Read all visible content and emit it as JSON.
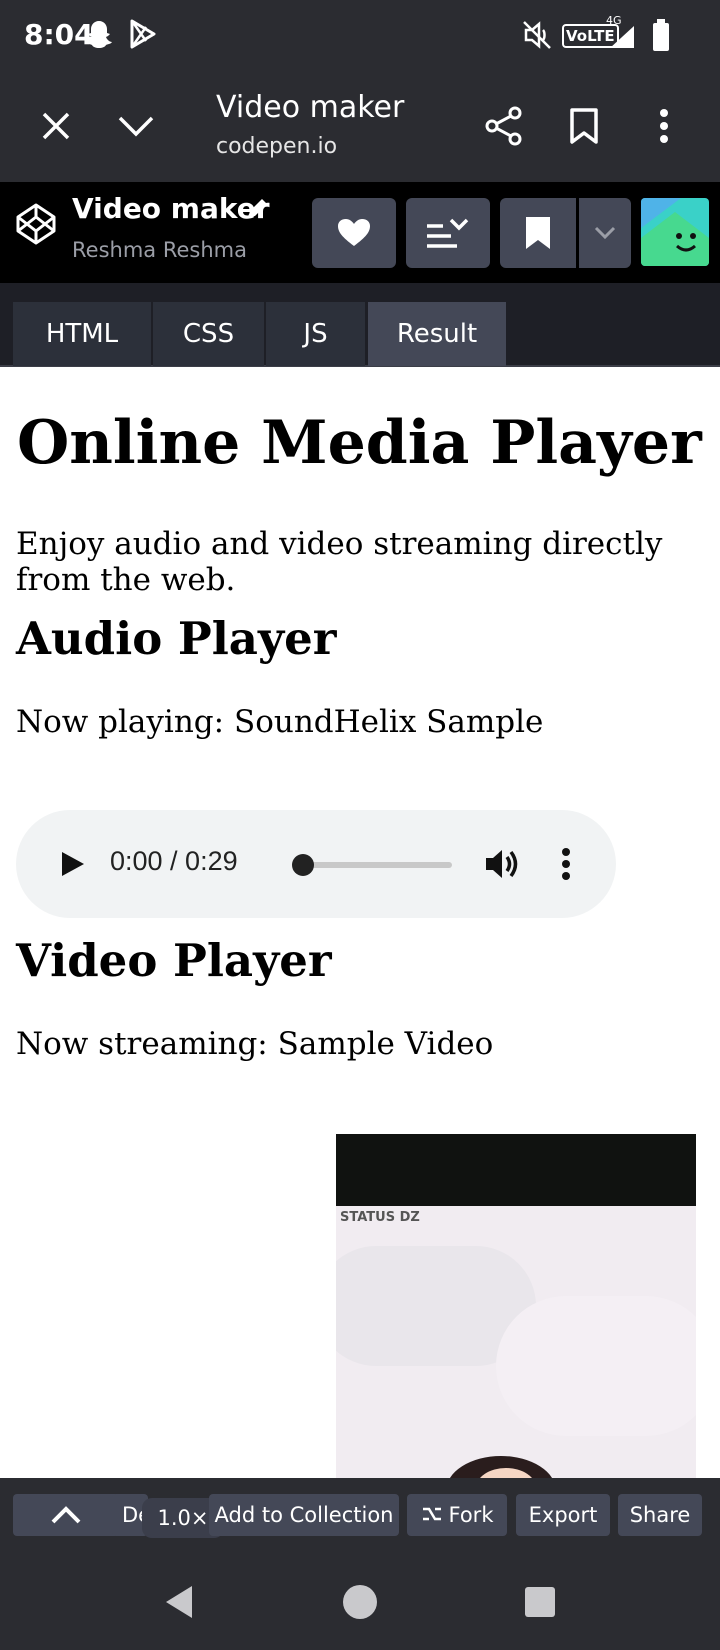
{
  "status_bar": {
    "time": "8:04",
    "icons": [
      "snapchat-icon",
      "play-store-icon",
      "mute-icon",
      "volte-icon",
      "signal-4g-icon",
      "battery-icon"
    ],
    "volte_label": "VoLTE",
    "network_label": "4G"
  },
  "browser": {
    "title": "Video maker",
    "url": "codepen.io"
  },
  "codepen": {
    "pen_title": "Video maker",
    "author": "Reshma Reshma"
  },
  "editor_tabs": [
    {
      "label": "HTML",
      "active": false
    },
    {
      "label": "CSS",
      "active": false
    },
    {
      "label": "JS",
      "active": false
    },
    {
      "label": "Result",
      "active": true
    }
  ],
  "result": {
    "heading": "Online Media Player",
    "intro": "Enjoy audio and video streaming directly from the web.",
    "audio_heading": "Audio Player",
    "audio_now_playing": "Now playing: SoundHelix Sample",
    "audio_time": "0:00 / 0:29",
    "audio_progress": 0,
    "video_heading": "Video Player",
    "video_now_streaming": "Now streaming: Sample Video",
    "video_watermark": "STATUS DZ"
  },
  "bottom_bar": {
    "partial_label": "De",
    "zoom": "1.0×",
    "add_to_collection": "Add to Collection",
    "fork": "Fork",
    "export": "Export",
    "share": "Share"
  },
  "colors": {
    "chrome_bg": "#2b2c31",
    "codepen_header_bg": "#000000",
    "button_bg": "#444857",
    "tab_active_bg": "#444857",
    "audio_control_bg": "#f1f3f4"
  }
}
